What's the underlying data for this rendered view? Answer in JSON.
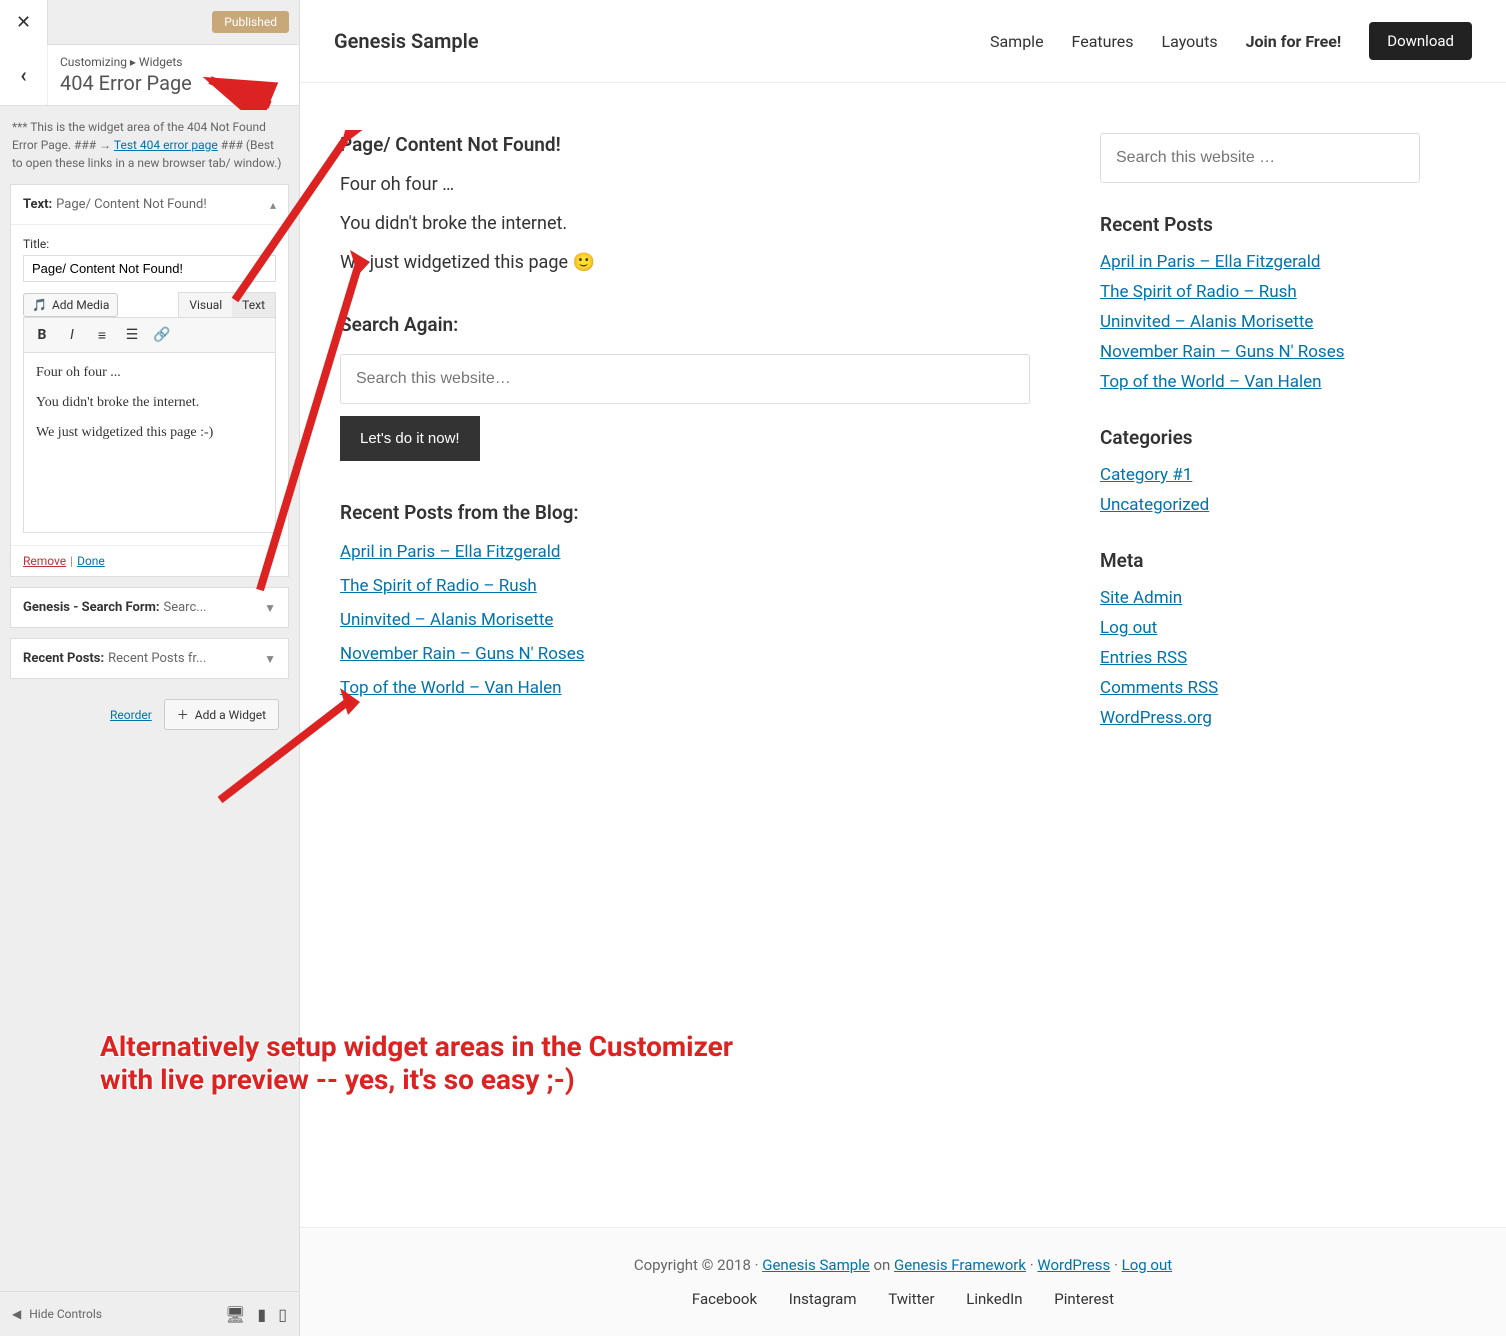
{
  "customizer": {
    "published_label": "Published",
    "breadcrumb": "Customizing ▸ Widgets",
    "section_title": "404 Error Page",
    "description_pre": "*** This is the widget area of the 404 Not Found Error Page. ### → ",
    "description_link": "Test 404 error page",
    "description_post": " ### (Best to open these links in a new browser tab/ window.)",
    "widget1": {
      "type": "Text:",
      "title": "Page/ Content Not Found!",
      "field_label": "Title:",
      "field_value": "Page/ Content Not Found!",
      "add_media": "Add Media",
      "tab_visual": "Visual",
      "tab_text": "Text",
      "body_p1": "Four oh four ...",
      "body_p2": "You didn't broke the internet.",
      "body_p3": "We just widgetized this page :-)",
      "remove": "Remove",
      "done": "Done"
    },
    "widget2": {
      "type": "Genesis - Search Form:",
      "title": "Searc..."
    },
    "widget3": {
      "type": "Recent Posts:",
      "title": "Recent Posts fr..."
    },
    "reorder": "Reorder",
    "add_widget": "Add a Widget",
    "hide_controls": "Hide Controls"
  },
  "preview": {
    "site_title": "Genesis Sample",
    "nav": {
      "sample": "Sample",
      "features": "Features",
      "layouts": "Layouts",
      "join": "Join for Free!",
      "download": "Download"
    },
    "main": {
      "h1": "Page/ Content Not Found!",
      "p1": "Four oh four …",
      "p2": "You didn't broke the internet.",
      "p3": "We just widgetized this page 🙂",
      "search_heading": "Search Again:",
      "search_placeholder": "Search this website…",
      "search_btn": "Let's do it now!",
      "recent_heading": "Recent Posts from the Blog:"
    },
    "recent_posts": [
      "April in Paris – Ella Fitzgerald",
      "The Spirit of Radio – Rush",
      "Uninvited – Alanis Morisette",
      "November Rain – Guns N' Roses",
      "Top of the World – Van Halen"
    ],
    "sidebar": {
      "search_placeholder": "Search this website …",
      "recent_h": "Recent Posts",
      "cat_h": "Categories",
      "categories": [
        "Category #1",
        "Uncategorized"
      ],
      "meta_h": "Meta",
      "meta": [
        "Site Admin",
        "Log out",
        "Entries RSS",
        "Comments RSS",
        "WordPress.org"
      ]
    },
    "footer": {
      "copyright": "Copyright © 2018 · ",
      "l1": "Genesis Sample",
      "on": " on ",
      "l2": "Genesis Framework",
      "dot1": " · ",
      "l3": "WordPress",
      "dot2": " · ",
      "l4": "Log out",
      "social": [
        "Facebook",
        "Instagram",
        "Twitter",
        "LinkedIn",
        "Pinterest"
      ]
    }
  },
  "annotation": {
    "line1": "Alternatively setup widget areas in the Customizer",
    "line2": "with live preview -- yes, it's so easy ;-)"
  }
}
